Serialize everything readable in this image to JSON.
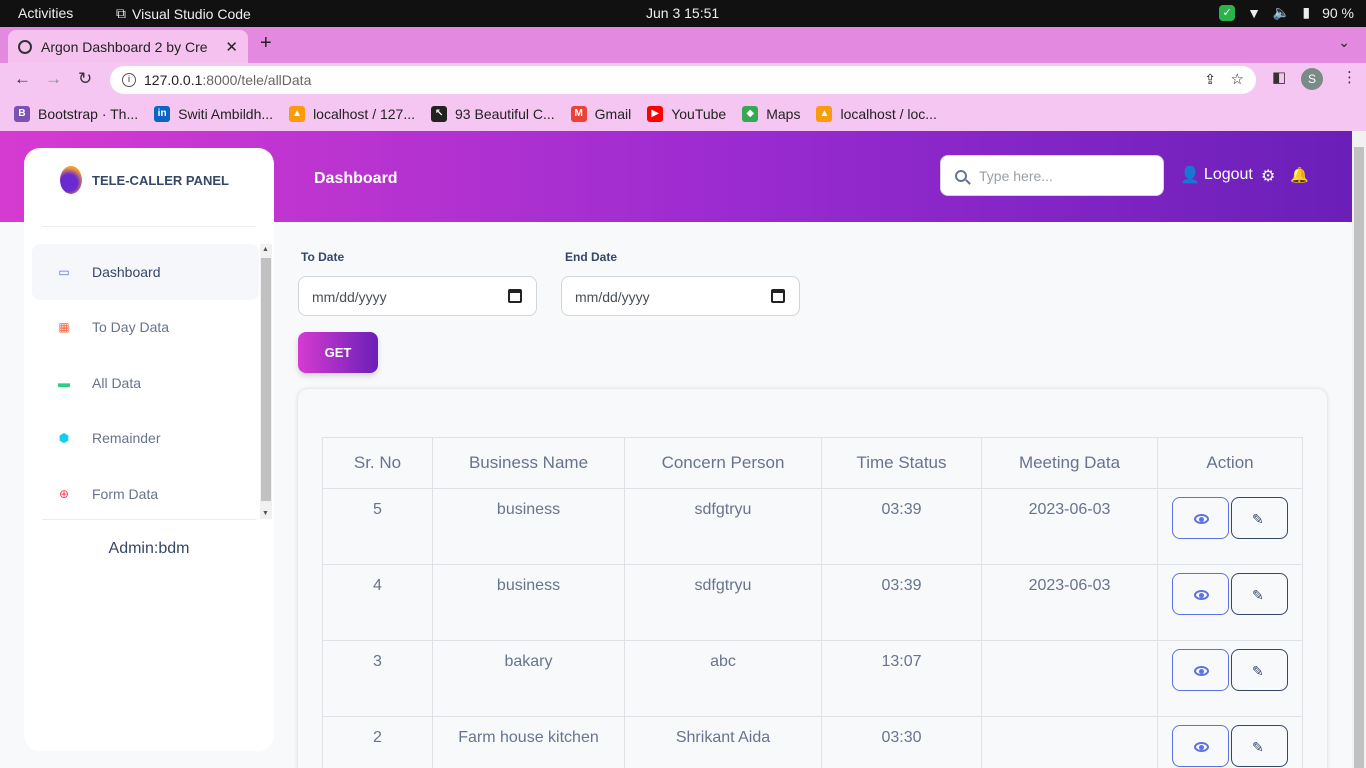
{
  "os": {
    "activities": "Activities",
    "app": "Visual Studio Code",
    "clock": "Jun 3  15:51",
    "battery": "90 %"
  },
  "browser": {
    "tab_title": "Argon Dashboard 2 by Cre",
    "url_host": "127.0.0.1",
    "url_path": ":8000/tele/allData",
    "profile_initial": "S",
    "bookmarks": [
      "Bootstrap · Th...",
      "Switi Ambildh...",
      "localhost / 127...",
      "93 Beautiful C...",
      "Gmail",
      "YouTube",
      "Maps",
      "localhost / loc..."
    ]
  },
  "header": {
    "breadcrumb": "Dashboard",
    "search_placeholder": "Type here...",
    "logout": "Logout"
  },
  "sidebar": {
    "brand": "TELE-CALLER PANEL",
    "items": [
      {
        "label": "Dashboard",
        "icon": "monitor-icon",
        "color": "#5e72e4"
      },
      {
        "label": "To Day Data",
        "icon": "calendar-icon",
        "color": "#fb6340"
      },
      {
        "label": "All Data",
        "icon": "credit-card-icon",
        "color": "#2dce89"
      },
      {
        "label": "Remainder",
        "icon": "box-icon",
        "color": "#11cdef"
      },
      {
        "label": "Form Data",
        "icon": "globe-icon",
        "color": "#f5365c"
      }
    ],
    "admin": "Admin:bdm"
  },
  "filters": {
    "to_label": "To Date",
    "end_label": "End Date",
    "to_value": "mm/dd/yyyy",
    "end_value": "mm/dd/yyyy",
    "get": "GET"
  },
  "table": {
    "headers": [
      "Sr. No",
      "Business Name",
      "Concern Person",
      "Time Status",
      "Meeting Data",
      "Action"
    ],
    "rows": [
      [
        "5",
        "business",
        "sdfgtryu",
        "03:39",
        "2023-06-03"
      ],
      [
        "4",
        "business",
        "sdfgtryu",
        "03:39",
        "2023-06-03"
      ],
      [
        "3",
        "bakary",
        "abc",
        "13:07",
        ""
      ],
      [
        "2",
        "Farm house kitchen",
        "Shrikant Aida",
        "03:30",
        ""
      ]
    ]
  },
  "colors": {
    "accent_start": "#d63bd1",
    "accent_end": "#6a1fb8",
    "primary": "#5e72e4"
  }
}
